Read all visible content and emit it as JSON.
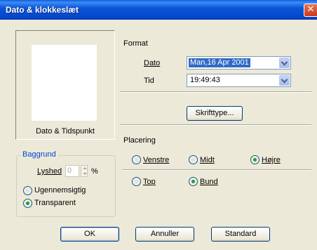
{
  "window": {
    "title": "Dato & klokkeslæt",
    "close_glyph": "✕"
  },
  "preview": {
    "caption": "Dato & Tidspunkt"
  },
  "background": {
    "legend": "Baggrund",
    "brightness_label": "Lyshed",
    "brightness_value": "0",
    "percent": "%",
    "opaque_label": "Ugennemsigtig",
    "transparent_label": "Transparent",
    "selected": "Transparent"
  },
  "format": {
    "heading": "Format",
    "date_label": "Dato",
    "date_value": "Man,16 Apr 2001",
    "time_label": "Tid",
    "time_value": "19:49:43",
    "font_button": "Skrifttype..."
  },
  "placement": {
    "heading": "Placering",
    "left": "Venstre",
    "middle": "Midt",
    "right": "Højre",
    "top": "Top",
    "bottom": "Bund",
    "horizontal_selected": "Højre",
    "vertical_selected": "Bund"
  },
  "buttons": {
    "ok": "OK",
    "cancel": "Annuller",
    "standard": "Standard"
  }
}
